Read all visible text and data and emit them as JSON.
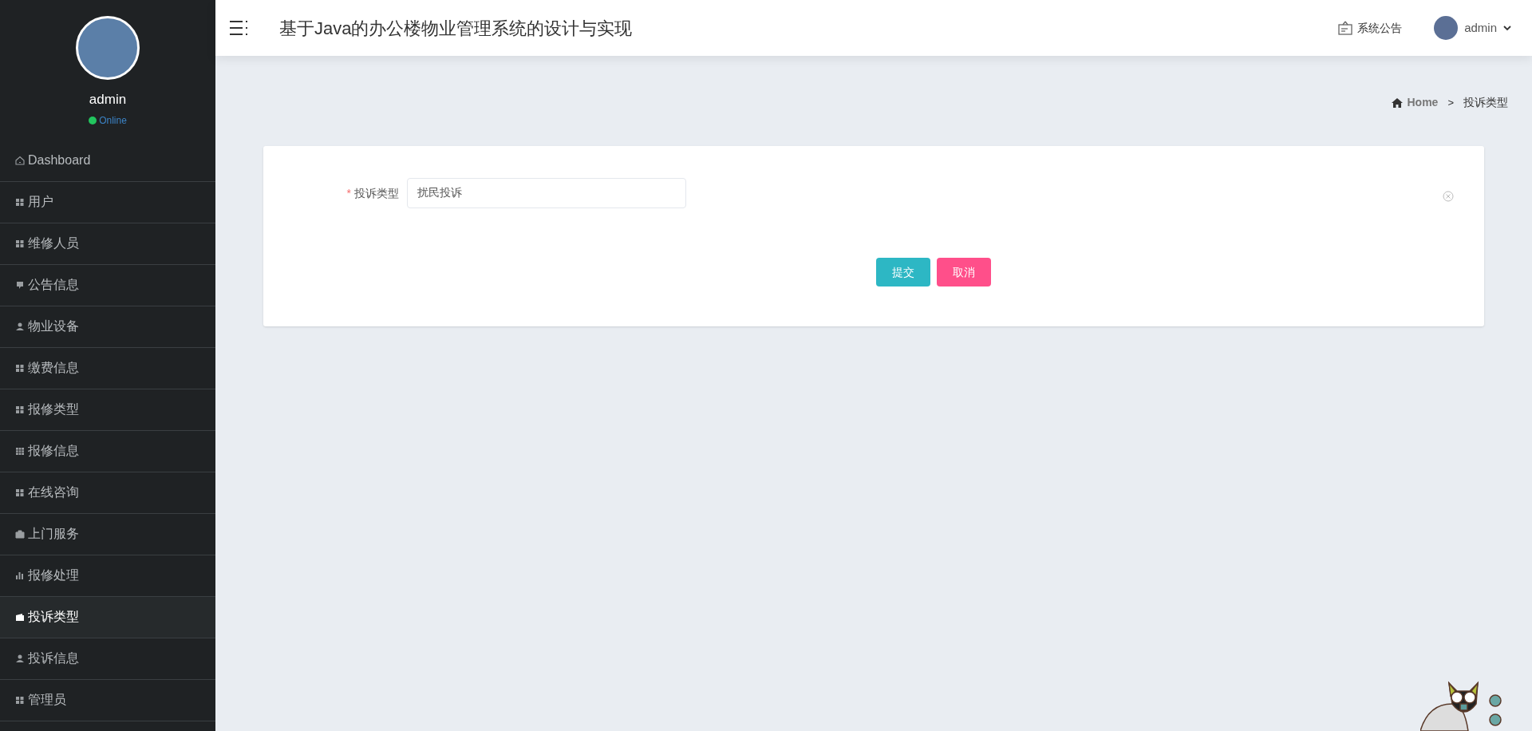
{
  "sidebar": {
    "user": {
      "name": "admin",
      "status": "Online"
    },
    "items": [
      {
        "label": "Dashboard",
        "selected": false
      },
      {
        "label": "用户",
        "selected": false
      },
      {
        "label": "维修人员",
        "selected": false
      },
      {
        "label": "公告信息",
        "selected": false
      },
      {
        "label": "物业设备",
        "selected": false
      },
      {
        "label": "缴费信息",
        "selected": false
      },
      {
        "label": "报修类型",
        "selected": false
      },
      {
        "label": "报修信息",
        "selected": false
      },
      {
        "label": "在线咨询",
        "selected": false
      },
      {
        "label": "上门服务",
        "selected": false
      },
      {
        "label": "报修处理",
        "selected": false
      },
      {
        "label": "投诉类型",
        "selected": true
      },
      {
        "label": "投诉信息",
        "selected": false
      },
      {
        "label": "管理员",
        "selected": false
      }
    ]
  },
  "header": {
    "title": "基于Java的办公楼物业管理系统的设计与实现",
    "notice": "系统公告",
    "user": "admin"
  },
  "breadcrumb": {
    "home": "Home",
    "separator": ">",
    "current": "投诉类型"
  },
  "form": {
    "fields": [
      {
        "label": "投诉类型",
        "required_mark": "*",
        "value": "扰民投诉"
      }
    ],
    "buttons": [
      {
        "label": "提交",
        "kind": "submit"
      },
      {
        "label": "取消",
        "kind": "cancel"
      }
    ]
  }
}
